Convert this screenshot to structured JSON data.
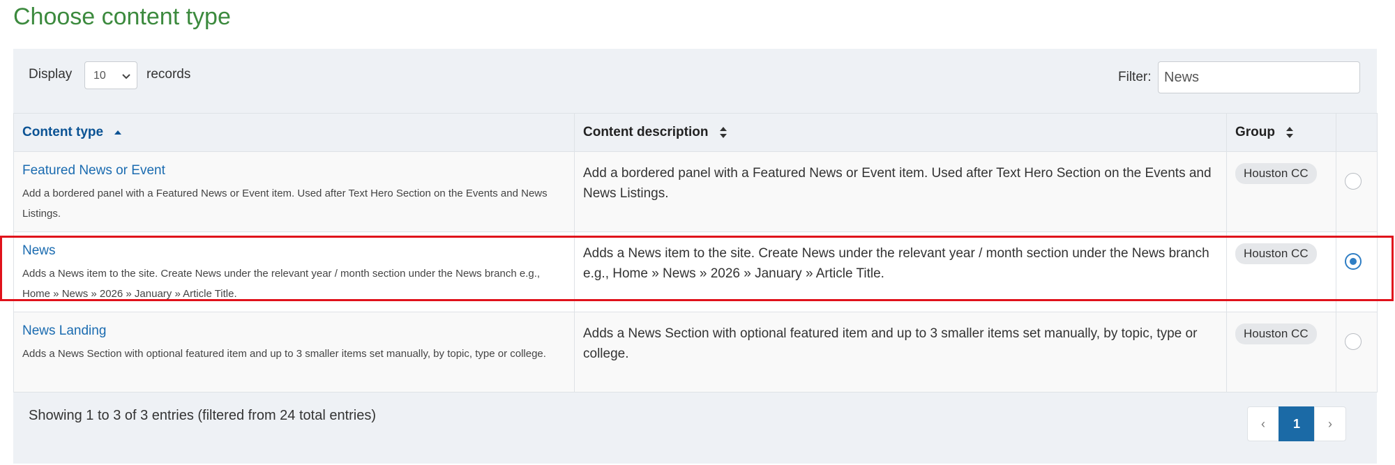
{
  "page": {
    "title": "Choose content type"
  },
  "controls": {
    "display_label": "Display",
    "length_value": "10",
    "records_label": "records",
    "filter_label": "Filter:",
    "filter_value": "News"
  },
  "table": {
    "headers": {
      "content_type": "Content type",
      "content_description": "Content description",
      "group": "Group"
    },
    "rows": [
      {
        "name": "Featured News or Event",
        "short_desc": "Add a bordered panel with a Featured News or Event item. Used after Text Hero Section on the Events and News Listings.",
        "description": "Add a bordered panel with a Featured News or Event item. Used after Text Hero Section on the Events and News Listings.",
        "group": "Houston CC",
        "selected": false
      },
      {
        "name": "News",
        "short_desc": "Adds a News item to the site. Create News under the relevant year / month section under the News branch e.g., Home » News » 2026 » January » Article Title.",
        "description": "Adds a News item to the site. Create News under the relevant year / month section under the News branch e.g., Home » News » 2026 » January » Article Title.",
        "group": "Houston CC",
        "selected": true
      },
      {
        "name": "News Landing",
        "short_desc": "Adds a News Section with optional featured item and up to 3 smaller items set manually, by topic, type or college.",
        "description": "Adds a News Section with optional featured item and up to 3 smaller items set manually, by topic, type or college.",
        "group": "Houston CC",
        "selected": false
      }
    ]
  },
  "footer": {
    "info": "Showing 1 to 3 of 3 entries (filtered from 24 total entries)",
    "prev": "‹",
    "current_page": "1",
    "next": "›"
  },
  "colors": {
    "title_green": "#3c8a3e",
    "link_blue": "#1a6bb0",
    "highlight_red": "#e0121b",
    "page_active": "#1b6aa6"
  }
}
